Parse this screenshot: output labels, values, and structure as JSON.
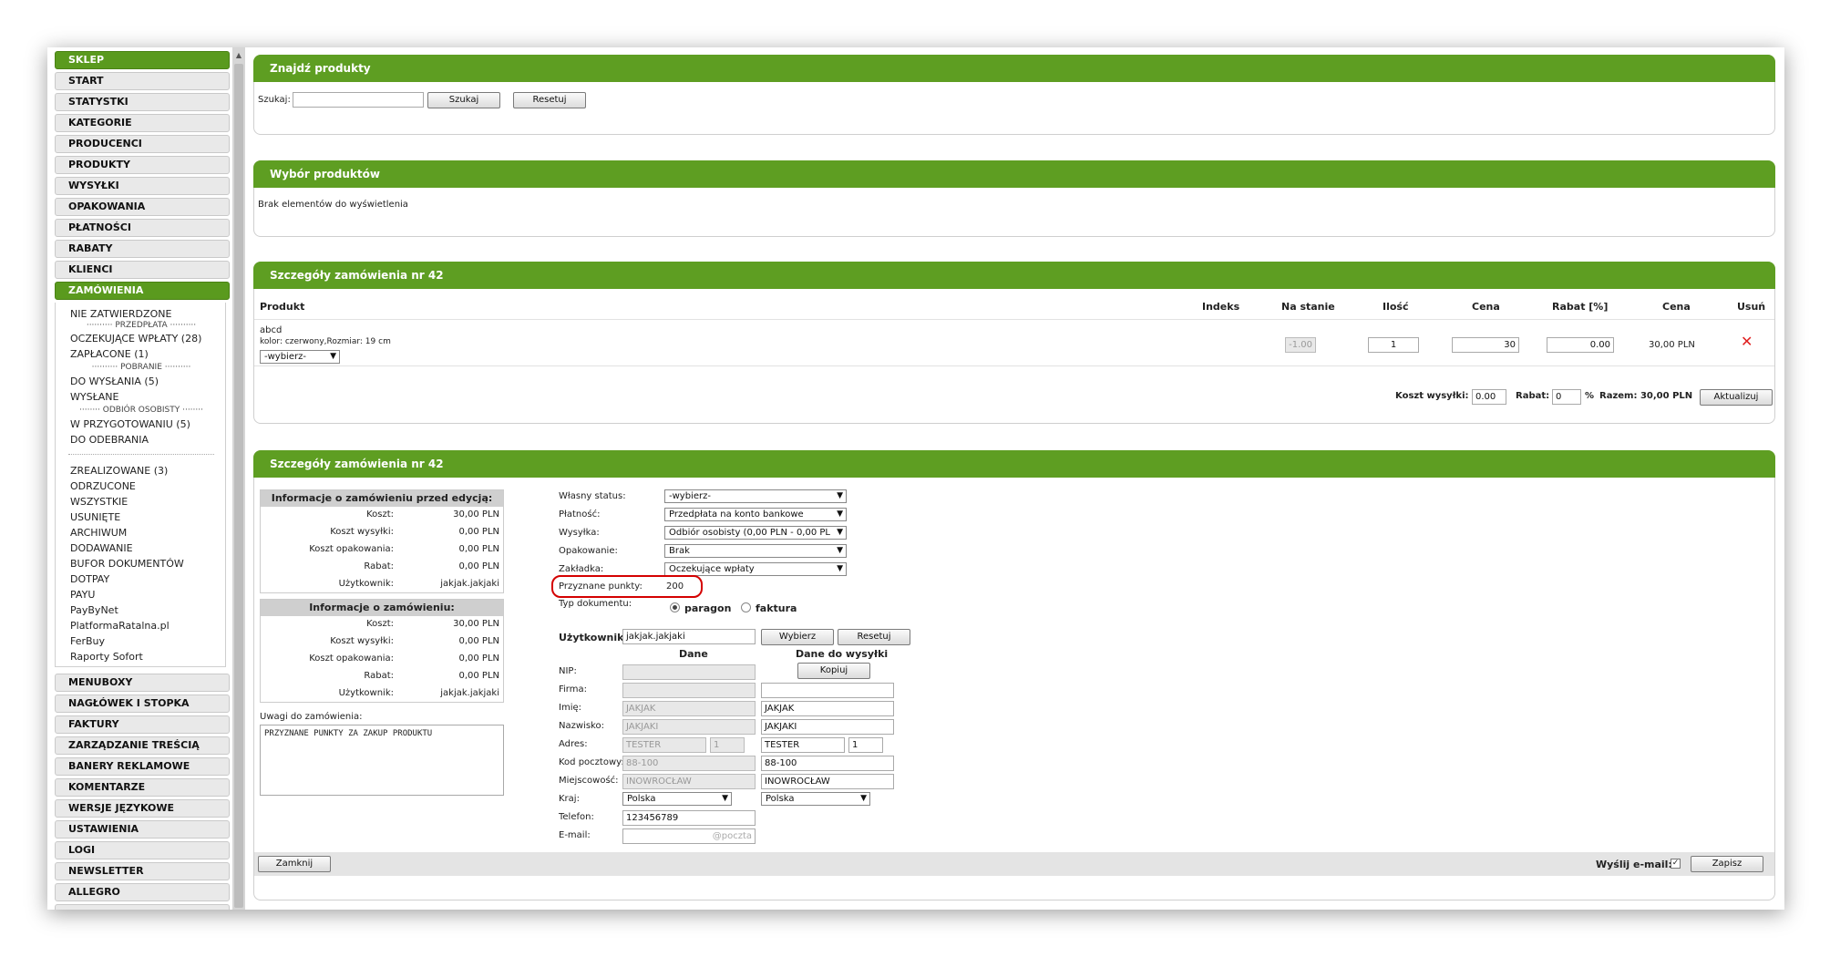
{
  "sidebar": {
    "top": [
      {
        "label": "SKLEP",
        "active": true
      },
      {
        "label": "START"
      },
      {
        "label": "STATYSTKI"
      },
      {
        "label": "KATEGORIE"
      },
      {
        "label": "PRODUCENCI"
      },
      {
        "label": "PRODUKTY"
      },
      {
        "label": "WYSYŁKI"
      },
      {
        "label": "OPAKOWANIA"
      },
      {
        "label": "PŁATNOŚCI"
      },
      {
        "label": "RABATY"
      },
      {
        "label": "KLIENCI"
      },
      {
        "label": "ZAMÓWIENIA",
        "active": true
      }
    ],
    "submenu": {
      "nie_zatwierdzone": "NIE ZATWIERDZONE",
      "sep_przedplata": "PRZEDPŁATA",
      "oczekujace": "OCZEKUJĄCE WPŁATY (28)",
      "zaplacone": "ZAPŁACONE (1)",
      "sep_pobranie": "POBRANIE",
      "do_wyslania": "DO WYSŁANIA (5)",
      "wyslane": "WYSŁANE",
      "sep_odbior": "ODBIÓR OSOBISTY",
      "w_przygotowaniu": "W PRZYGOTOWANIU (5)",
      "do_odebrania": "DO ODEBRANIA",
      "zrealizowane": "ZREALIZOWANE (3)",
      "odrzucone": "ODRZUCONE",
      "wszystkie": "WSZYSTKIE",
      "usuniete": "USUNIĘTE",
      "archiwum": "ARCHIWUM",
      "dodawanie": "DODAWANIE",
      "bufor": "BUFOR DOKUMENTÓW",
      "dotpay": "DOTPAY",
      "payu": "PAYU",
      "paybynet": "PayByNet",
      "platforma": "PlatformaRatalna.pl",
      "ferbuy": "FerBuy",
      "raporty": "Raporty Sofort"
    },
    "bottom": [
      {
        "label": "MENUBOXY"
      },
      {
        "label": "NAGŁÓWEK I STOPKA"
      },
      {
        "label": "FAKTURY"
      },
      {
        "label": "ZARZĄDZANIE TREŚCIĄ"
      },
      {
        "label": "BANERY REKLAMOWE"
      },
      {
        "label": "KOMENTARZE"
      },
      {
        "label": "WERSJE JĘZYKOWE"
      },
      {
        "label": "USTAWIENIA"
      },
      {
        "label": "LOGI"
      },
      {
        "label": "NEWSLETTER"
      },
      {
        "label": "ALLEGRO"
      }
    ]
  },
  "find": {
    "title": "Znajdź produkty",
    "search_label": "Szukaj:",
    "search_value": "",
    "search_button": "Szukaj",
    "reset_button": "Resetuj"
  },
  "selection": {
    "title": "Wybór produktów",
    "empty": "Brak elementów do wyświetlenia"
  },
  "order": {
    "title": "Szczegóły zamówienia nr 42",
    "headers": {
      "produkt": "Produkt",
      "indeks": "Indeks",
      "na_stanie": "Na stanie",
      "ilosc": "Ilość",
      "cena": "Cena",
      "rabat": "Rabat [%]",
      "cena2": "Cena",
      "usun": "Usuń"
    },
    "item": {
      "name": "abcd",
      "attrs": "kolor: czerwony,Rozmiar: 19 cm",
      "variant": "-wybierz-",
      "stock": "-1.00",
      "qty": "1",
      "price": "30",
      "discount": "0.00",
      "total": "30,00 PLN"
    },
    "shipping_label": "Koszt wysyłki:",
    "shipping_value": "0.00",
    "discount_label": "Rabat:",
    "discount_value": "0",
    "percent": "%",
    "sum": "Razem: 30,00 PLN",
    "update_button": "Aktualizuj"
  },
  "details": {
    "title": "Szczegóły zamówienia nr 42",
    "before": {
      "title": "Informacje o zamówieniu przed edycją:",
      "rows": [
        {
          "k": "Koszt:",
          "v": "30,00 PLN"
        },
        {
          "k": "Koszt wysyłki:",
          "v": "0,00 PLN"
        },
        {
          "k": "Koszt opakowania:",
          "v": "0,00 PLN"
        },
        {
          "k": "Rabat:",
          "v": "0,00 PLN"
        },
        {
          "k": "Użytkownik:",
          "v": "jakjak.jakjaki"
        }
      ]
    },
    "after": {
      "title": "Informacje o zamówieniu:",
      "rows": [
        {
          "k": "Koszt:",
          "v": "30,00 PLN"
        },
        {
          "k": "Koszt wysyłki:",
          "v": "0,00 PLN"
        },
        {
          "k": "Koszt opakowania:",
          "v": "0,00 PLN"
        },
        {
          "k": "Rabat:",
          "v": "0,00 PLN"
        },
        {
          "k": "Użytkownik:",
          "v": "jakjak.jakjaki"
        }
      ]
    },
    "notes_label": "Uwagi do zamówienia:",
    "notes_value": "PRZYZNANE PUNKTY ZA ZAKUP PRODUKTU",
    "status_label": "Własny status:",
    "status_value": "-wybierz-",
    "payment_label": "Płatność:",
    "payment_value": "Przedpłata na konto bankowe",
    "shipping_label": "Wysyłka:",
    "shipping_value": "Odbiór osobisty (0,00 PLN - 0,00 PL",
    "packaging_label": "Opakowanie:",
    "packaging_value": "Brak",
    "tab_label": "Zakładka:",
    "tab_value": "Oczekujące wpłaty",
    "points_label": "Przyznane punkty:",
    "points_value": "200",
    "doctype_label": "Typ dokumentu:",
    "doc_paragon": "paragon",
    "doc_faktura": "faktura",
    "user_label": "Użytkownik:",
    "user_value": "jakjak.jakjaki",
    "choose_button": "Wybierz",
    "reset_button": "Resetuj",
    "col_data": "Dane",
    "col_shipping": "Dane do wysyłki",
    "copy_button": "Kopiuj",
    "fields": {
      "nip": "NIP:",
      "firma": "Firma:",
      "imie": "Imię:",
      "nazwisko": "Nazwisko:",
      "adres": "Adres:",
      "kod": "Kod pocztowy:",
      "miejscowosc": "Miejscowość:",
      "kraj": "Kraj:",
      "telefon": "Telefon:",
      "email": "E-mail:"
    },
    "data": {
      "imie": "JAKJAK",
      "nazwisko": "JAKJAKI",
      "ulica": "TESTER",
      "nr": "1",
      "kod": "88-100",
      "miasto": "INOWROCŁAW",
      "kraj": "Polska",
      "telefon": "123456789",
      "email": "@poczta"
    },
    "ship": {
      "imie": "JAKJAK",
      "nazwisko": "JAKJAKI",
      "ulica": "TESTER",
      "nr": "1",
      "kod": "88-100",
      "miasto": "INOWROCŁAW",
      "kraj": "Polska"
    },
    "close_button": "Zamknij",
    "send_email_label": "Wyślij e-mail:",
    "save_button": "Zapisz"
  }
}
